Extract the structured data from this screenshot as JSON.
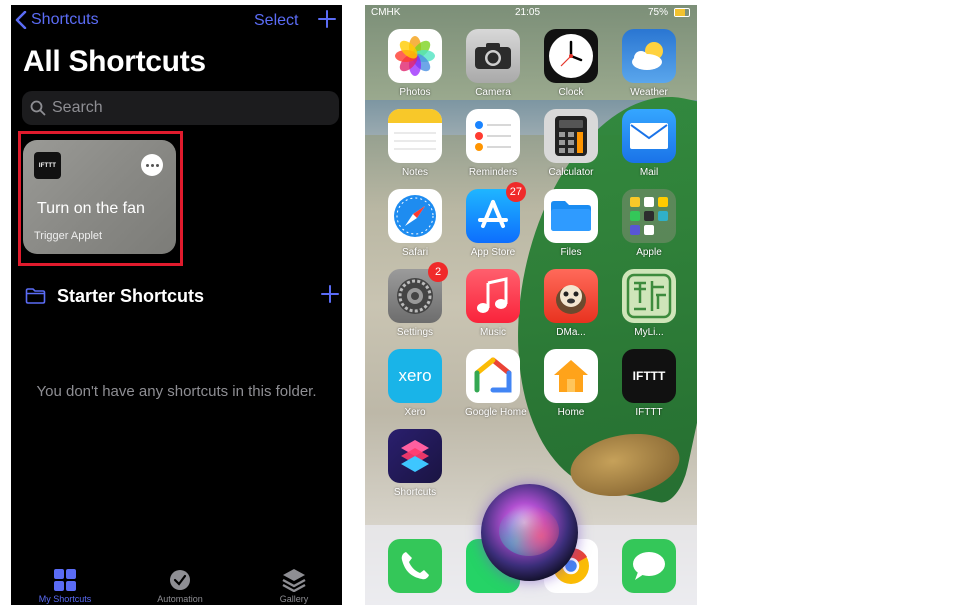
{
  "left_panel": {
    "nav": {
      "back_label": "Shortcuts",
      "select_label": "Select"
    },
    "title": "All Shortcuts",
    "search": {
      "placeholder": "Search"
    },
    "shortcut_card": {
      "logo_text": "IFTTT",
      "title": "Turn on the fan",
      "subtitle": "Trigger Applet"
    },
    "folder": {
      "title": "Starter Shortcuts"
    },
    "empty_message": "You don't have any shortcuts in this folder.",
    "tabs": [
      {
        "label": "My Shortcuts",
        "icon": "grid-icon",
        "active": true
      },
      {
        "label": "Automation",
        "icon": "check-clock-icon",
        "active": false
      },
      {
        "label": "Gallery",
        "icon": "layers-icon",
        "active": false
      }
    ]
  },
  "right_panel": {
    "status_bar": {
      "carrier": "CMHK",
      "time": "21:05",
      "battery": "75%"
    },
    "apps": [
      {
        "label": "Photos",
        "icon": "photos-icon"
      },
      {
        "label": "Camera",
        "icon": "camera-icon"
      },
      {
        "label": "Clock",
        "icon": "clock-icon"
      },
      {
        "label": "Weather",
        "icon": "weather-icon"
      },
      {
        "label": "Notes",
        "icon": "notes-icon"
      },
      {
        "label": "Reminders",
        "icon": "reminders-icon"
      },
      {
        "label": "Calculator",
        "icon": "calculator-icon"
      },
      {
        "label": "Mail",
        "icon": "mail-icon"
      },
      {
        "label": "Safari",
        "icon": "safari-icon"
      },
      {
        "label": "App Store",
        "icon": "app-store-icon",
        "badge": "27"
      },
      {
        "label": "Files",
        "icon": "files-icon"
      },
      {
        "label": "Apple",
        "icon": "apple-folder-icon"
      },
      {
        "label": "Settings",
        "icon": "settings-icon",
        "badge": "2"
      },
      {
        "label": "Music",
        "icon": "music-icon"
      },
      {
        "label": "DMa...",
        "icon": "dma-icon"
      },
      {
        "label": "MyLi...",
        "icon": "myli-icon"
      },
      {
        "label": "Xero",
        "icon": "xero-icon",
        "logo_text": "xero"
      },
      {
        "label": "Google Home",
        "icon": "google-home-icon"
      },
      {
        "label": "Home",
        "icon": "home-icon"
      },
      {
        "label": "IFTTT",
        "icon": "ifttt-icon",
        "logo_text": "IFTTT"
      },
      {
        "label": "Shortcuts",
        "icon": "shortcuts-icon"
      }
    ],
    "dock": [
      {
        "icon": "phone-icon"
      },
      {
        "icon": "whatsapp-icon"
      },
      {
        "icon": "chrome-icon"
      },
      {
        "icon": "messages-icon"
      }
    ]
  }
}
